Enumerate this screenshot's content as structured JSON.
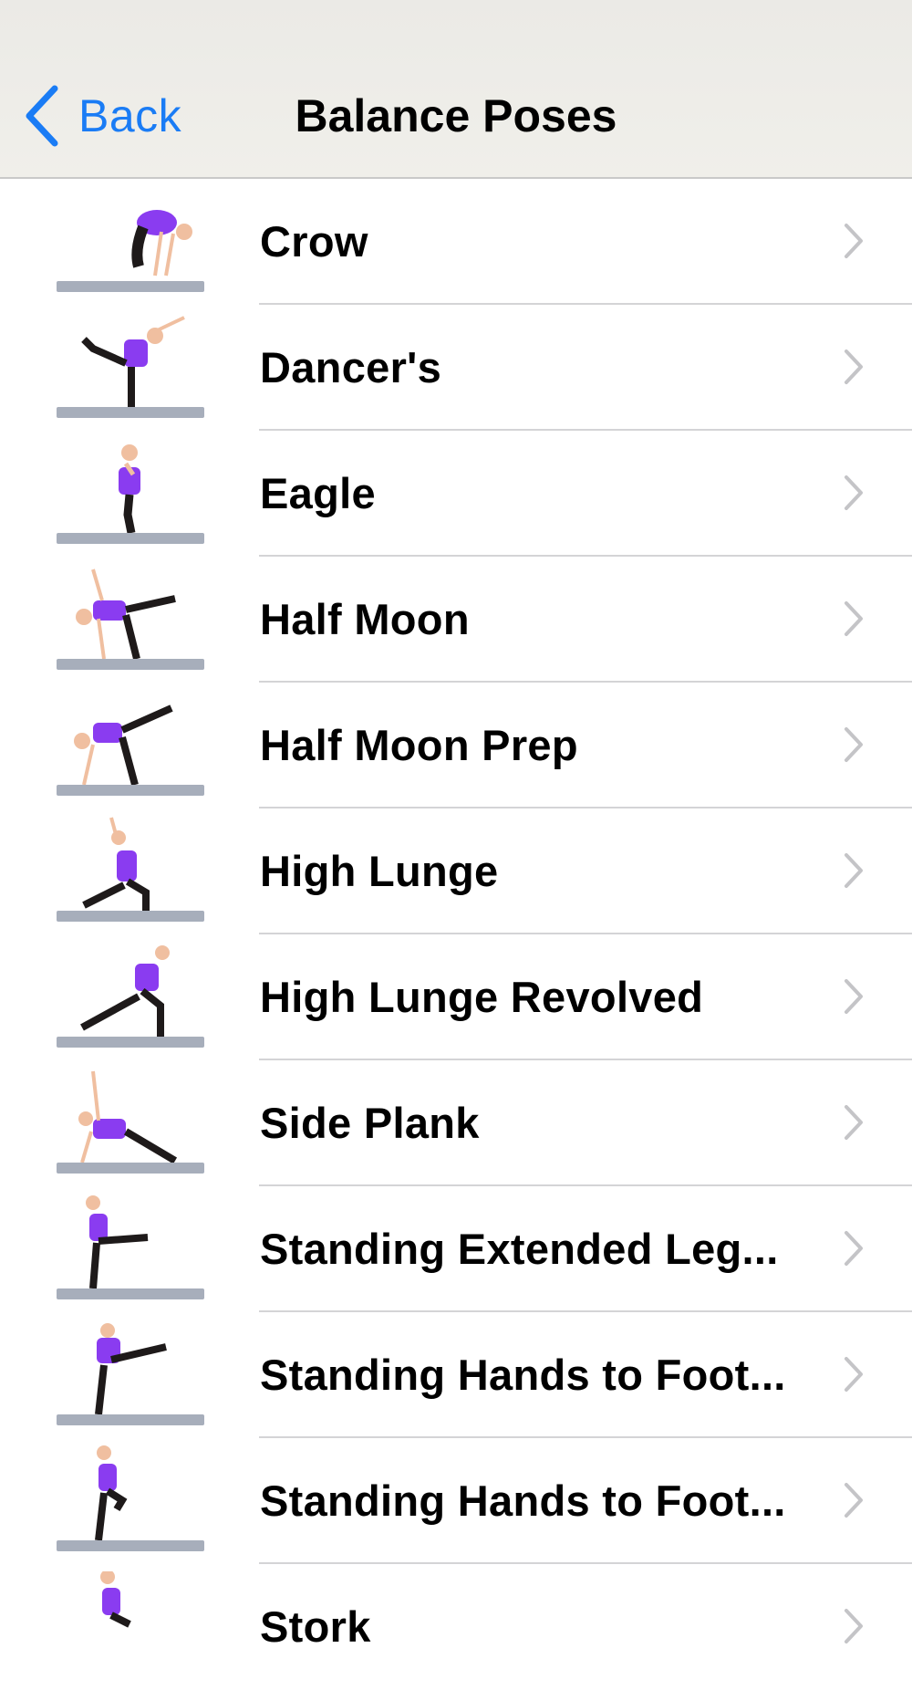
{
  "nav": {
    "back_label": "Back",
    "title": "Balance Poses",
    "back_icon": "chevron-left-icon",
    "accent": "#1a7cf5"
  },
  "poses": [
    {
      "label": "Crow"
    },
    {
      "label": "Dancer's"
    },
    {
      "label": "Eagle"
    },
    {
      "label": "Half Moon"
    },
    {
      "label": "Half Moon Prep"
    },
    {
      "label": "High Lunge"
    },
    {
      "label": "High Lunge Revolved"
    },
    {
      "label": "Side Plank"
    },
    {
      "label": "Standing Extended Leg..."
    },
    {
      "label": "Standing Hands to Foot..."
    },
    {
      "label": "Standing Hands to Foot..."
    },
    {
      "label": "Stork"
    }
  ],
  "row_icon": "chevron-right-icon",
  "colors": {
    "top_purple": "#8a3cf0",
    "pants": "#1e1a1a",
    "mat": "#a7aebb",
    "skin": "#f0bfa0",
    "separator": "#d4d4d6",
    "chevron": "#c4c4c7"
  }
}
